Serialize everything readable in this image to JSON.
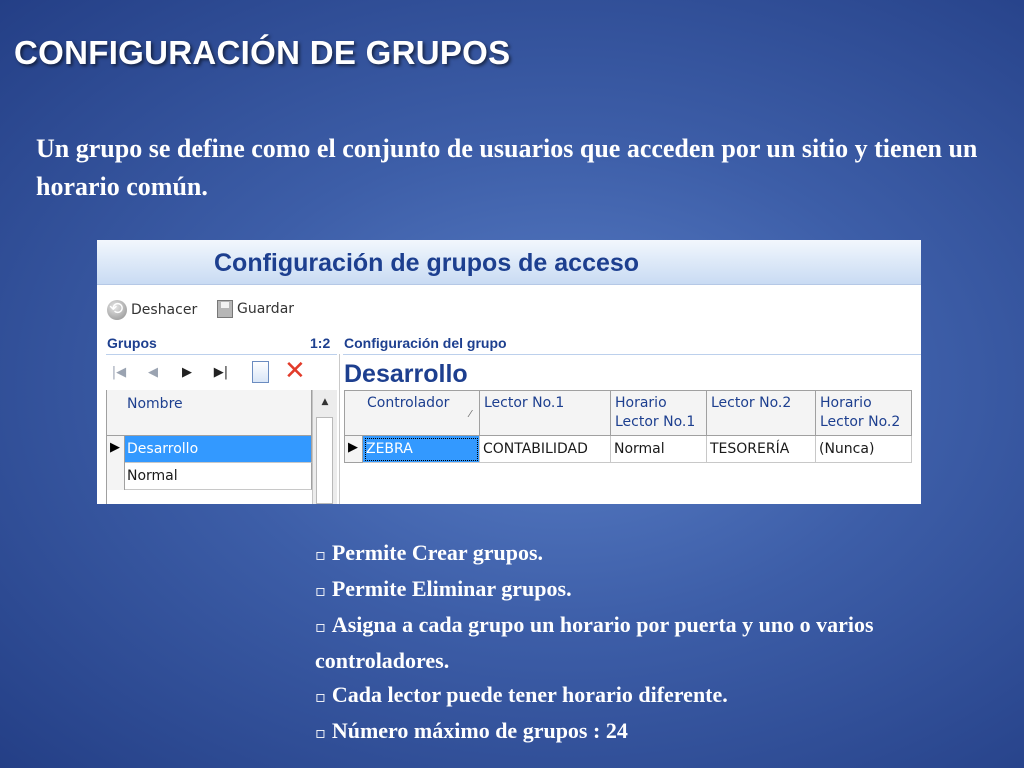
{
  "slide": {
    "title": "CONFIGURACIÓN DE GRUPOS",
    "intro": "Un grupo se define como el conjunto de usuarios que acceden por un sitio y tienen un horario común."
  },
  "app": {
    "window_title": "Configuración de grupos de acceso",
    "toolbar": {
      "undo_label": "Deshacer",
      "save_label": "Guardar"
    },
    "groups_panel": {
      "label": "Grupos",
      "counter": "1:2",
      "column_header": "Nombre",
      "rows": [
        "Desarrollo",
        "Normal"
      ],
      "selected_index": 0
    },
    "group_config": {
      "label": "Configuración del grupo",
      "group_name": "Desarrollo",
      "columns": [
        "Controlador",
        "Lector No.1",
        "Horario Lector No.1",
        "Lector No.2",
        "Horario Lector No.2"
      ],
      "rows": [
        [
          "ZEBRA",
          "CONTABILIDAD",
          "Normal",
          "TESORERÍA",
          "(Nunca)"
        ]
      ]
    },
    "icons": {
      "undo": "undo-icon",
      "save": "save-icon",
      "first": "first-record-icon",
      "prev": "previous-record-icon",
      "next": "next-record-icon",
      "last": "last-record-icon",
      "new": "new-document-icon",
      "delete": "delete-x-icon"
    },
    "colors": {
      "title_text": "#1d3f8f",
      "selection": "#3399ff",
      "delete": "#e23b2a"
    }
  },
  "bullets": [
    "Permite Crear grupos.",
    "Permite Eliminar grupos.",
    "Asigna a cada grupo un horario por puerta y uno o varios controladores.",
    "Cada lector puede tener horario diferente.",
    "Número máximo de grupos : 24"
  ]
}
